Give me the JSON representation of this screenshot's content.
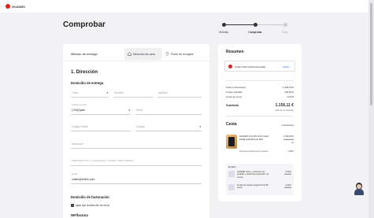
{
  "brand": {
    "name": "HUAWEI",
    "color": "#d9251c"
  },
  "page_title": "Comprobar",
  "steps": [
    {
      "label": "Mi bolsa",
      "state": "done"
    },
    {
      "label": "Comprobar",
      "state": "current"
    },
    {
      "label": "Pago",
      "state": "pending"
    }
  ],
  "method": {
    "label": "Método de entrega",
    "tabs": [
      {
        "label": "Dirección de casa",
        "icon": "house-icon",
        "active": true
      },
      {
        "label": "Punto de recogida",
        "icon": "location-pin-icon",
        "active": false
      }
    ]
  },
  "address": {
    "title": "1. Dirección",
    "shipping_title": "Domicilio de entrega",
    "title_field": "Título",
    "first_name": "Nombre",
    "surname": "Apellido",
    "prefix_caption": "Código de país",
    "prefix_value": "(+34)Spain",
    "phone": "Móvil",
    "postal": "Código Postal",
    "city": "Ciudad",
    "address_ph": "Dirección*",
    "detail_ph": "Detalle adicional (p. ej., departamento, compañía, unidad, Apartado)",
    "email_caption": "Email",
    "email_value": "chelle@vhello.com",
    "billing_title": "Domicilio de facturación",
    "billing_same": "Igual que la dirección de envío",
    "nif": "NIF/factura"
  },
  "summary": {
    "title": "Resumen",
    "coupon_text": "Cupón 11% Inspiring benefits",
    "coupon_edit": "Editar",
    "rows": [
      {
        "label": "Total (1 Artículo(s))",
        "value": "1.299,00 €"
      },
      {
        "label": "Cupón aplicado",
        "value": "- 142,89 €"
      },
      {
        "label": "Coste de envío",
        "value": "0,00 €"
      }
    ],
    "subtotal_label": "Subtotal",
    "subtotal_value": "1.156,11 €",
    "tax_note": "(IVA 21 % incluido)"
  },
  "cart": {
    "title": "Cesta",
    "count": "1 artículo(s)",
    "product_name": "HUAWEI Pura 80 Ultra 5 años 16GB+512GB Dual SIM",
    "product_price": "1.299,00 €",
    "product_old": "1.299,00 €",
    "product_qty": "×1",
    "service_name": "Entrega estándar Envío gratuito",
    "service_price": "0,00 €",
    "gift_title": "Regalo",
    "gifts": [
      {
        "name": "HUAWEI Care+: protección de pantalla + asistencia reparación 12 meses",
        "price": "0,00 €",
        "old": "79,00 €"
      },
      {
        "name": "Funda de Huawei Vegana Pura 80 series",
        "price": "0,00 €",
        "old": "39,00 €"
      }
    ]
  }
}
